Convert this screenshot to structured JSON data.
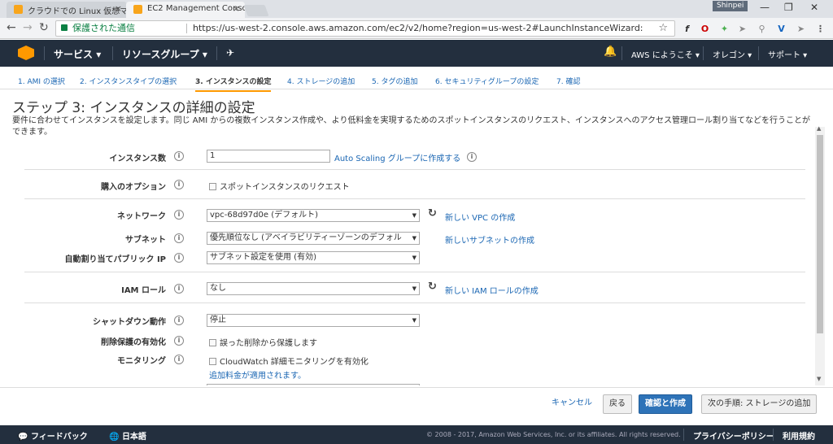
{
  "browser": {
    "tabs": [
      {
        "title": "クラウドでの Linux 仮想マシ"
      },
      {
        "title": "EC2 Management Conso"
      }
    ],
    "user_badge": "Shinpei",
    "secure_label": "保護された通信",
    "url": "https://us-west-2.console.aws.amazon.com/ec2/v2/home?region=us-west-2#LaunchInstanceWizard:"
  },
  "aws_header": {
    "services": "サービス",
    "resource_groups": "リソースグループ",
    "welcome": "AWS にようこそ",
    "region": "オレゴン",
    "support": "サポート"
  },
  "wizard_steps": [
    {
      "label": "1. AMI の選択"
    },
    {
      "label": "2. インスタンスタイプの選択"
    },
    {
      "label": "3. インスタンスの設定"
    },
    {
      "label": "4. ストレージの追加"
    },
    {
      "label": "5. タグの追加"
    },
    {
      "label": "6. セキュリティグループの設定"
    },
    {
      "label": "7. 確認"
    }
  ],
  "page": {
    "title": "ステップ 3: インスタンスの詳細の設定",
    "description": "要件に合わせてインスタンスを設定します。同じ AMI からの複数インスタンス作成や、より低料金を実現するためのスポットインスタンスのリクエスト、インスタンスへのアクセス管理ロール割り当てなどを行うことができます。"
  },
  "form": {
    "instance_count": {
      "label": "インスタンス数",
      "value": "1",
      "link": "Auto Scaling グループに作成する"
    },
    "purchase_option": {
      "label": "購入のオプション",
      "checkbox": "スポットインスタンスのリクエスト"
    },
    "network": {
      "label": "ネットワーク",
      "value": "vpc-68d97d0e (デフォルト)",
      "link": "新しい VPC の作成"
    },
    "subnet": {
      "label": "サブネット",
      "value": "優先順位なし (アベイラビリティーゾーンのデフォル",
      "link": "新しいサブネットの作成"
    },
    "auto_ip": {
      "label": "自動割り当てパブリック IP",
      "value": "サブネット設定を使用 (有効)"
    },
    "iam_role": {
      "label": "IAM ロール",
      "value": "なし",
      "link": "新しい IAM ロールの作成"
    },
    "shutdown": {
      "label": "シャットダウン動作",
      "value": "停止"
    },
    "termination": {
      "label": "削除保護の有効化",
      "checkbox": "誤った削除から保護します"
    },
    "monitoring": {
      "label": "モニタリング",
      "checkbox": "CloudWatch 詳細モニタリングを有効化",
      "link": "追加料金が適用されます。"
    }
  },
  "actions": {
    "cancel": "キャンセル",
    "back": "戻る",
    "review": "確認と作成",
    "next": "次の手順: ストレージの追加"
  },
  "footer": {
    "feedback": "フィードバック",
    "language": "日本語",
    "copyright": "© 2008 - 2017, Amazon Web Services, Inc. or its affiliates. All rights reserved.",
    "privacy": "プライバシーポリシー",
    "terms": "利用規約"
  }
}
